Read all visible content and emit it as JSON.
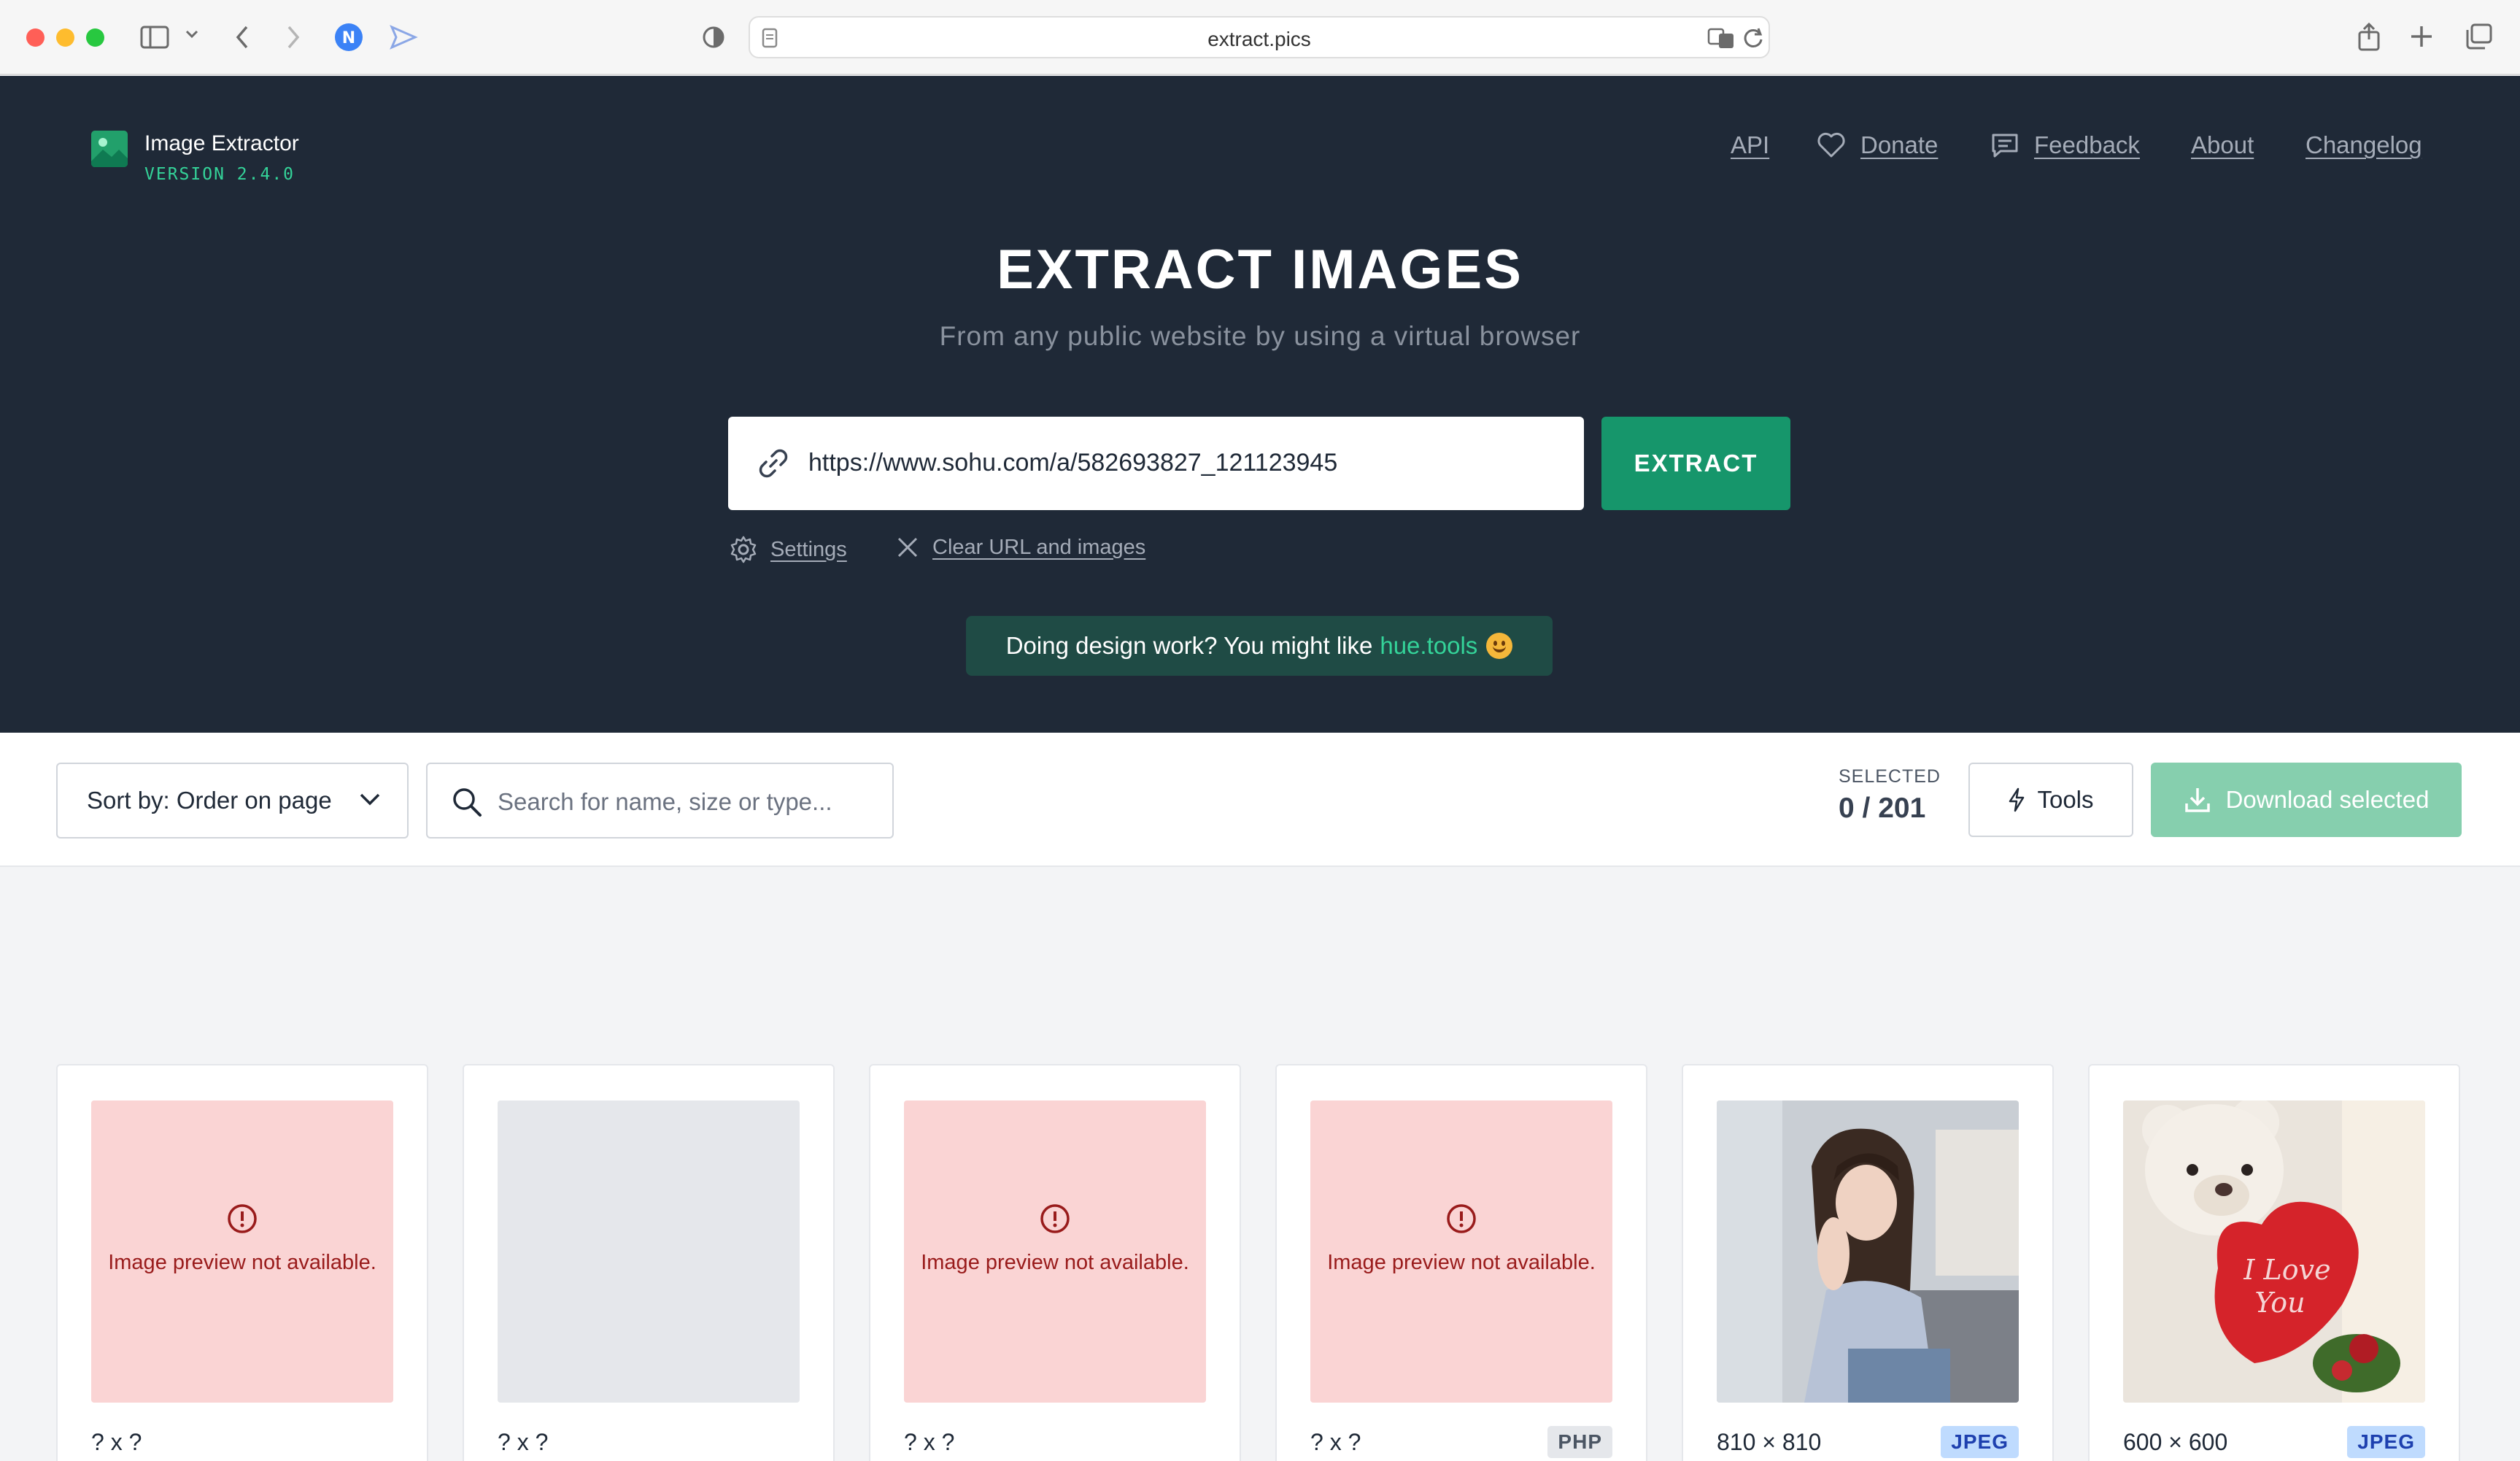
{
  "browser": {
    "url": "extract.pics"
  },
  "header": {
    "brand": "Image Extractor",
    "version": "VERSION 2.4.0",
    "nav": {
      "api": "API",
      "donate": "Donate",
      "feedback": "Feedback",
      "about": "About",
      "changelog": "Changelog"
    }
  },
  "hero": {
    "title": "EXTRACT IMAGES",
    "subtitle": "From any public website by using a virtual browser",
    "url_value": "https://www.sohu.com/a/582693827_121123945",
    "extract_label": "EXTRACT",
    "settings_label": "Settings",
    "clear_label": "Clear URL and images",
    "promo_text": "Doing design work? You might like",
    "promo_link": "hue.tools"
  },
  "toolbar": {
    "sort_label": "Sort by: Order on page",
    "search_placeholder": "Search for name, size or type...",
    "selected_label": "SELECTED",
    "selected_count": "0 / 201",
    "tools_label": "Tools",
    "download_label": "Download selected"
  },
  "cards": [
    {
      "preview": "error",
      "error_text": "Image preview not available.",
      "dims": "? x ?",
      "badge": ""
    },
    {
      "preview": "empty",
      "error_text": "",
      "dims": "? x ?",
      "badge": ""
    },
    {
      "preview": "error",
      "error_text": "Image preview not available.",
      "dims": "? x ?",
      "badge": ""
    },
    {
      "preview": "error",
      "error_text": "Image preview not available.",
      "dims": "? x ?",
      "badge": "PHP"
    },
    {
      "preview": "photo-woman",
      "error_text": "",
      "dims": "810 × 810",
      "badge": "JPEG"
    },
    {
      "preview": "photo-bear",
      "error_text": "",
      "dims": "600 × 600",
      "badge": "JPEG"
    }
  ],
  "colors": {
    "hero_bg": "#1f2937",
    "accent": "#16966b",
    "accent_light": "#34d399",
    "error_bg": "#fad4d4",
    "error_text": "#991b1b"
  }
}
